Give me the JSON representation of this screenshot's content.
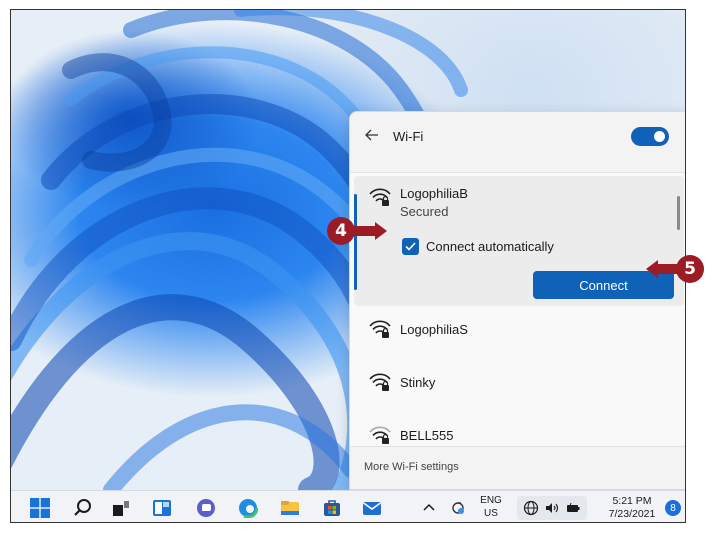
{
  "wifi_panel": {
    "title": "Wi-Fi",
    "toggle_on": true,
    "selected_network": {
      "name": "LogophiliaB",
      "status": "Secured",
      "connect_automatically_label": "Connect automatically",
      "connect_automatically_checked": true,
      "connect_label": "Connect",
      "icon": "wifi-secured-icon"
    },
    "networks": [
      {
        "name": "LogophiliaS",
        "icon": "wifi-secured-icon"
      },
      {
        "name": "Stinky",
        "icon": "wifi-secured-icon"
      },
      {
        "name": "BELL555",
        "icon": "wifi-secured-weak-icon"
      }
    ],
    "footer_link": "More Wi-Fi settings"
  },
  "callouts": [
    {
      "number": "4",
      "target": "connect-automatically-checkbox"
    },
    {
      "number": "5",
      "target": "connect-button"
    }
  ],
  "taskbar": {
    "apps": [
      "windows-start-icon",
      "search-icon",
      "task-view-icon",
      "widgets-icon",
      "chat-icon",
      "edge-icon",
      "file-explorer-icon",
      "store-icon",
      "mail-icon"
    ],
    "tray": {
      "language": "ENG",
      "region": "US",
      "time": "5:21 PM",
      "date": "7/23/2021",
      "notification_count": "8"
    }
  },
  "colors": {
    "accent": "#0f62b8",
    "callout": "#9b1c24",
    "taskbar": "#f1f3f7",
    "panel": "#f3f3f3"
  }
}
